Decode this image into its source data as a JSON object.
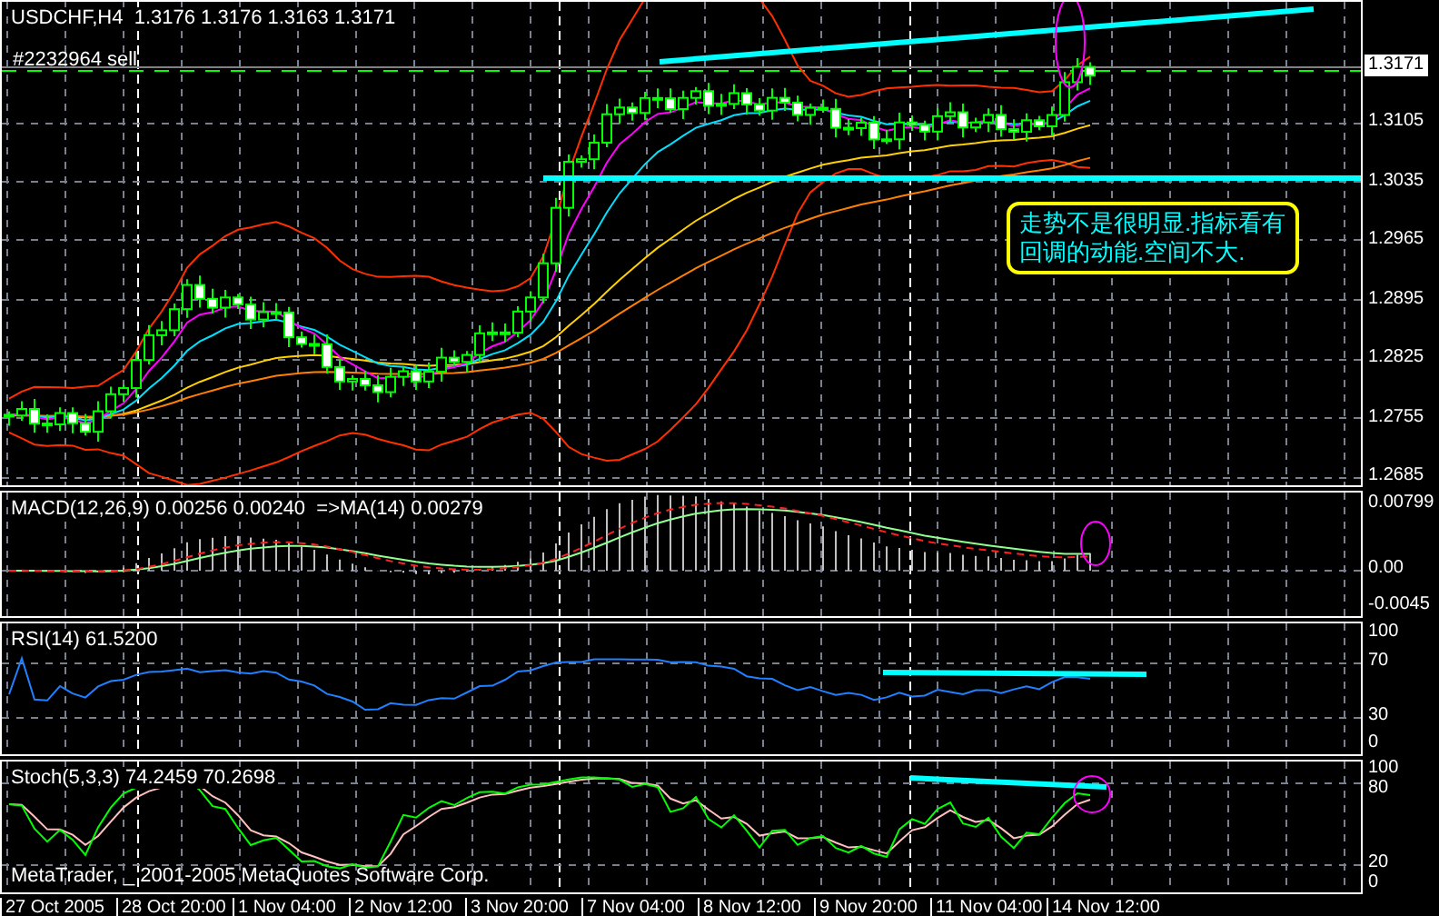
{
  "main": {
    "title": "USDCHF,H4  1.3176 1.3176 1.3163 1.3171",
    "order_label": "#2232964 sell",
    "current_price": "1.3171",
    "ticks": [
      "1.3105",
      "1.3035",
      "1.2965",
      "1.2895",
      "1.2825",
      "1.2755",
      "1.2685"
    ],
    "note": {
      "lines": [
        "走势不是很明显.指标看有",
        "回调的动能.空间不大."
      ]
    }
  },
  "indicators": [
    {
      "kind": "macd",
      "title": "MACD(12,26,9) 0.00256 0.00240  =>MA(14) 0.00279",
      "ticks": [
        "0.00799",
        "0.00",
        "-0.0045"
      ]
    },
    {
      "kind": "rsi",
      "title": "RSI(14) 61.5200",
      "ticks": [
        "100",
        "70",
        "30",
        "0"
      ]
    },
    {
      "kind": "stoch",
      "title": "Stoch(5,3,3) 74.2459 70.2698",
      "ticks": [
        "100",
        "80",
        "20",
        "0"
      ]
    }
  ],
  "copyright": "MetaTrader, _ 2001-2005 MetaQuotes Software Corp.",
  "time_axis": [
    "27 Oct 2005",
    "28 Oct 20:00",
    "1 Nov 04:00",
    "2 Nov 12:00",
    "3 Nov 20:00",
    "7 Nov 04:00",
    "8 Nov 12:00",
    "9 Nov 20:00",
    "11 Nov 04:00",
    "14 Nov 12:00"
  ]
}
